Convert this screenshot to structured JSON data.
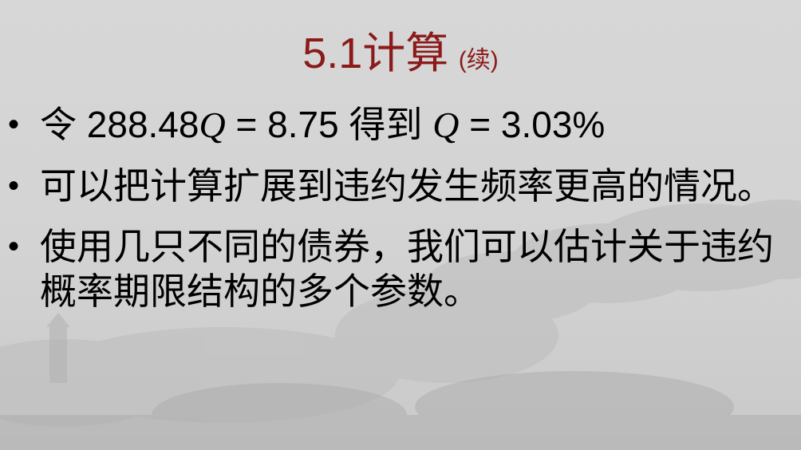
{
  "slide": {
    "title": "5.1计算",
    "title_suffix": "(续)",
    "bullet_symbol": "•",
    "bullets": [
      {
        "prefix": "令 288.48",
        "var1": "Q",
        "middle": " = 8.75 得到 ",
        "var2": "Q",
        "suffix": " = 3.03%"
      },
      {
        "text": "可以把计算扩展到违约发生频率更高的情况。"
      },
      {
        "text": "使用几只不同的债券，我们可以估计关于违约概率期限结构的多个参数。"
      }
    ]
  }
}
